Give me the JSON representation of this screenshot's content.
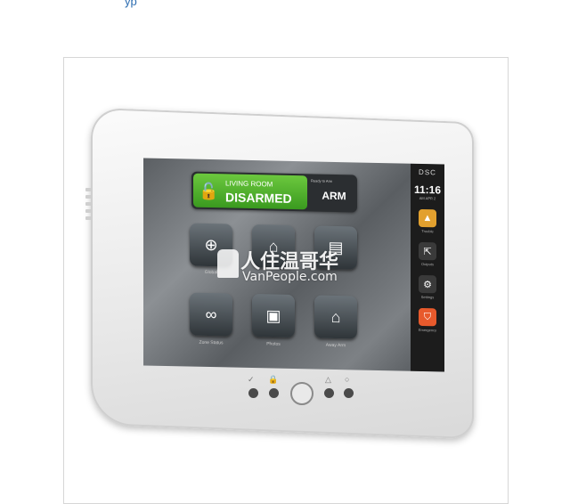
{
  "top_link": {
    "text": "yp"
  },
  "device": {
    "brand": "DSC",
    "clock": {
      "time": "11:16",
      "sub": "AM APR 2"
    },
    "status": {
      "room": "LIVING ROOM",
      "state": "DISARMED",
      "ready_text": "Ready to Arm",
      "arm_label": "ARM"
    },
    "tiles": [
      {
        "icon": "globe-icon",
        "glyph": "⊕",
        "label": "Global"
      },
      {
        "icon": "home-icon",
        "glyph": "⌂",
        "label": ""
      },
      {
        "icon": "document-icon",
        "glyph": "▤",
        "label": ""
      },
      {
        "icon": "chain-icon",
        "glyph": "∞",
        "label": "Zone Status"
      },
      {
        "icon": "photos-icon",
        "glyph": "▣",
        "label": "Photos"
      },
      {
        "icon": "away-icon",
        "glyph": "⌂",
        "label": "Away Arm"
      }
    ],
    "sidebar": [
      {
        "icon": "trouble-icon",
        "glyph": "▲",
        "label": "Trouble"
      },
      {
        "icon": "outputs-icon",
        "glyph": "⇱",
        "label": "Outputs"
      },
      {
        "icon": "settings-gear-icon",
        "glyph": "⚙",
        "label": "Settings"
      },
      {
        "icon": "emergency-shield-icon",
        "glyph": "⛉",
        "label": "Emergency"
      }
    ],
    "hardware_icons": [
      "✓",
      "🔒",
      "△",
      "○"
    ]
  },
  "watermark": {
    "cn": "人住温哥华",
    "en": "VanPeople.com"
  }
}
